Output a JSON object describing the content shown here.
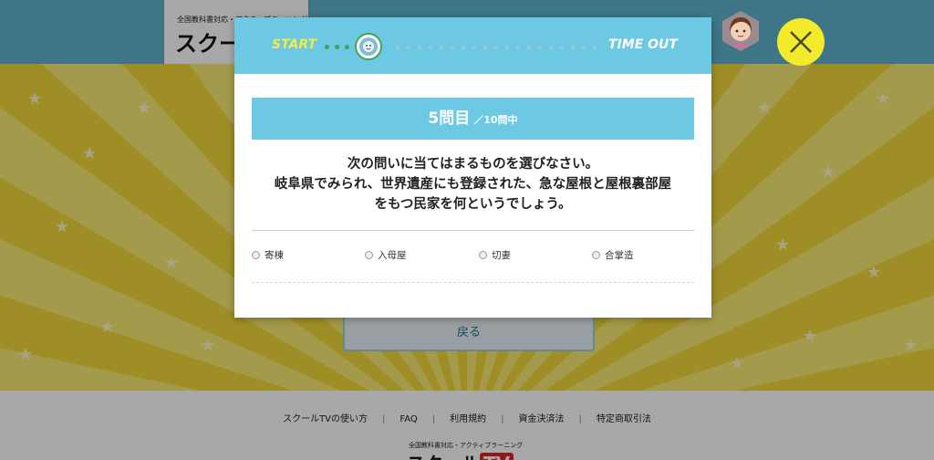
{
  "background": {
    "logo_sub": "全国教科書対応・アクティブラーニング",
    "logo_main": "スクールTV",
    "back_button": "戻る",
    "footer_links": [
      "スクールTVの使い方",
      "FAQ",
      "利用規約",
      "資金決済法",
      "特定商取引法"
    ],
    "footer_logo_sub": "全国教科書対応・アクティブラーニング",
    "footer_logo_main": "スクール",
    "footer_logo_tv": "TV"
  },
  "quiz": {
    "timer_start_label": "START",
    "timer_end_label": "TIME OUT",
    "progress_current_label": "5問目",
    "progress_total_label": "／10問中",
    "question_lines": [
      "次の問いに当てはまるものを選びなさい。",
      "岐阜県でみられ、世界遺産にも登録された、急な屋根と屋根裏部屋",
      "をもつ民家を何というでしょう。"
    ],
    "choices": [
      "寄棟",
      "入母屋",
      "切妻",
      "合掌造"
    ]
  },
  "colors": {
    "header_blue": "#6cc8e3",
    "topbar_blue": "#5fb3cd",
    "timer_elapsed": "#40a558",
    "timer_remaining": "#8ecadb",
    "start_yellow": "#f2ec46",
    "close_yellow": "#f4ea2c",
    "background_yellow": "#f6e04a"
  },
  "icons": {
    "close": "close-icon",
    "avatar": "avatar-icon",
    "timer_marker": "lion-icon"
  }
}
